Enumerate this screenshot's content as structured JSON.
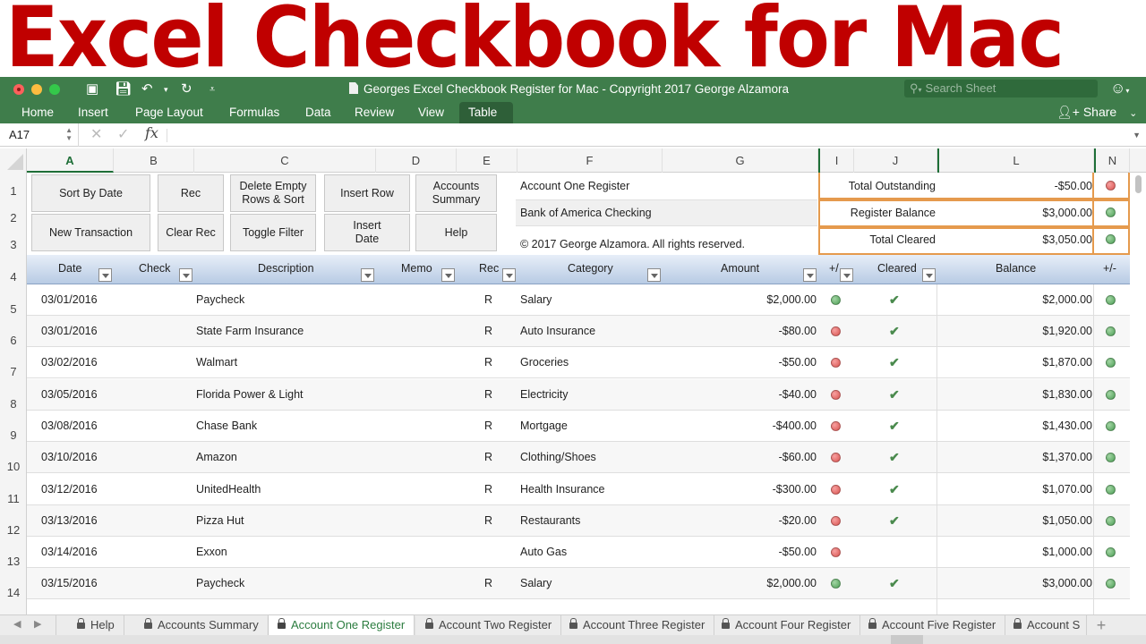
{
  "banner": {
    "title": "Excel Checkbook for Mac"
  },
  "window": {
    "title": "Georges Excel Checkbook Register for Mac - Copyright 2017 George Alzamora",
    "search_placeholder": "Search Sheet",
    "quick_access": [
      "sidebar-icon",
      "save-icon",
      "undo-icon",
      "redo-icon",
      "customize-icon"
    ]
  },
  "ribbon": {
    "tabs": [
      "Home",
      "Insert",
      "Page Layout",
      "Formulas",
      "Data",
      "Review",
      "View",
      "Table"
    ],
    "active_tab": "Table",
    "share_label": "Share"
  },
  "formula_bar": {
    "name_box": "A17",
    "fx_label": "fx",
    "formula": ""
  },
  "columns": [
    "A",
    "B",
    "C",
    "D",
    "E",
    "F",
    "G",
    "I",
    "J",
    "L",
    "N"
  ],
  "selected_column": "A",
  "row_numbers": [
    "1",
    "2",
    "3",
    "4",
    "5",
    "6",
    "7",
    "8",
    "9",
    "10",
    "11",
    "12",
    "13",
    "14"
  ],
  "buttons": {
    "sort_by_date": "Sort By Date",
    "rec": "Rec",
    "delete_empty": "Delete Empty Rows & Sort",
    "insert_row": "Insert Row",
    "accounts_summary": "Accounts Summary",
    "new_transaction": "New Transaction",
    "clear_rec": "Clear Rec",
    "toggle_filter": "Toggle Filter",
    "insert_date": "Insert Date",
    "help": "Help"
  },
  "info": {
    "register_name": "Account One Register",
    "bank_name": "Bank of America Checking",
    "copyright": "© 2017 George Alzamora.  All rights reserved."
  },
  "summary": [
    {
      "label": "Total Outstanding",
      "value": "-$50.00",
      "status": "red"
    },
    {
      "label": "Register Balance",
      "value": "$3,000.00",
      "status": "green"
    },
    {
      "label": "Total Cleared",
      "value": "$3,050.00",
      "status": "green"
    }
  ],
  "table": {
    "headers": {
      "date": "Date",
      "check": "Check",
      "description": "Description",
      "memo": "Memo",
      "rec": "Rec",
      "category": "Category",
      "amount": "Amount",
      "plusminus": "+/",
      "cleared": "Cleared",
      "balance": "Balance",
      "balance_pm": "+/-"
    },
    "rows": [
      {
        "date": "03/01/2016",
        "check": "",
        "description": "Paycheck",
        "memo": "",
        "rec": "R",
        "category": "Salary",
        "amount": "$2,000.00",
        "amount_status": "green",
        "cleared": true,
        "balance": "$2,000.00",
        "balance_status": "green"
      },
      {
        "date": "03/01/2016",
        "check": "",
        "description": "State Farm Insurance",
        "memo": "",
        "rec": "R",
        "category": "Auto Insurance",
        "amount": "-$80.00",
        "amount_status": "red",
        "cleared": true,
        "balance": "$1,920.00",
        "balance_status": "green"
      },
      {
        "date": "03/02/2016",
        "check": "",
        "description": "Walmart",
        "memo": "",
        "rec": "R",
        "category": "Groceries",
        "amount": "-$50.00",
        "amount_status": "red",
        "cleared": true,
        "balance": "$1,870.00",
        "balance_status": "green"
      },
      {
        "date": "03/05/2016",
        "check": "",
        "description": "Florida Power & Light",
        "memo": "",
        "rec": "R",
        "category": "Electricity",
        "amount": "-$40.00",
        "amount_status": "red",
        "cleared": true,
        "balance": "$1,830.00",
        "balance_status": "green"
      },
      {
        "date": "03/08/2016",
        "check": "",
        "description": "Chase Bank",
        "memo": "",
        "rec": "R",
        "category": "Mortgage",
        "amount": "-$400.00",
        "amount_status": "red",
        "cleared": true,
        "balance": "$1,430.00",
        "balance_status": "green"
      },
      {
        "date": "03/10/2016",
        "check": "",
        "description": "Amazon",
        "memo": "",
        "rec": "R",
        "category": "Clothing/Shoes",
        "amount": "-$60.00",
        "amount_status": "red",
        "cleared": true,
        "balance": "$1,370.00",
        "balance_status": "green"
      },
      {
        "date": "03/12/2016",
        "check": "",
        "description": "UnitedHealth",
        "memo": "",
        "rec": "R",
        "category": "Health Insurance",
        "amount": "-$300.00",
        "amount_status": "red",
        "cleared": true,
        "balance": "$1,070.00",
        "balance_status": "green"
      },
      {
        "date": "03/13/2016",
        "check": "",
        "description": "Pizza Hut",
        "memo": "",
        "rec": "R",
        "category": "Restaurants",
        "amount": "-$20.00",
        "amount_status": "red",
        "cleared": true,
        "balance": "$1,050.00",
        "balance_status": "green"
      },
      {
        "date": "03/14/2016",
        "check": "",
        "description": "Exxon",
        "memo": "",
        "rec": "",
        "category": "Auto Gas",
        "amount": "-$50.00",
        "amount_status": "red",
        "cleared": false,
        "balance": "$1,000.00",
        "balance_status": "green"
      },
      {
        "date": "03/15/2016",
        "check": "",
        "description": "Paycheck",
        "memo": "",
        "rec": "R",
        "category": "Salary",
        "amount": "$2,000.00",
        "amount_status": "green",
        "cleared": true,
        "balance": "$3,000.00",
        "balance_status": "green"
      }
    ],
    "check_glyph": "✔"
  },
  "sheet_tabs": {
    "tabs": [
      "Help",
      "Accounts Summary",
      "Account One Register",
      "Account Two Register",
      "Account Three Register",
      "Account Four Register",
      "Account Five Register",
      "Account S"
    ],
    "active": "Account One Register",
    "add_label": "+"
  },
  "colors": {
    "accent_green": "#3f7d4b",
    "banner_red": "#c00000",
    "summary_border": "#e59a4d",
    "status_red": "#d9534f",
    "status_green": "#4c9f55"
  }
}
